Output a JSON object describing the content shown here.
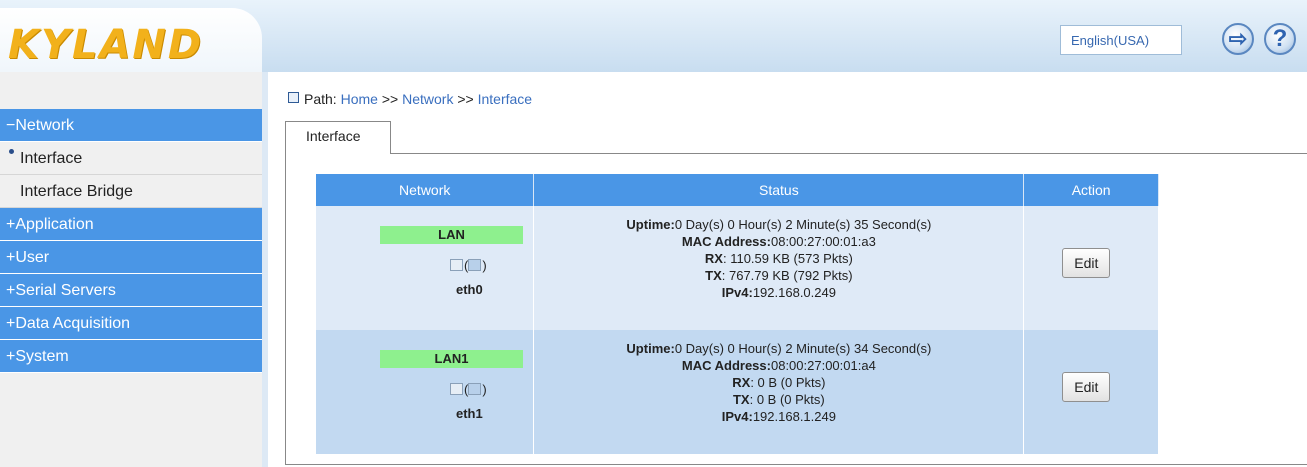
{
  "header": {
    "logo": "KYLAND",
    "language": "English(USA)",
    "exit_icon": "logout-icon",
    "help_icon": "?"
  },
  "sidebar": {
    "items": [
      {
        "label": "−Network",
        "type": "group"
      },
      {
        "label": "Interface",
        "type": "sub",
        "active": true
      },
      {
        "label": "Interface Bridge",
        "type": "sub"
      },
      {
        "label": "+Application",
        "type": "group"
      },
      {
        "label": "+User",
        "type": "group"
      },
      {
        "label": "+Serial Servers",
        "type": "group"
      },
      {
        "label": "+Data Acquisition",
        "type": "group"
      },
      {
        "label": "+System",
        "type": "group"
      }
    ]
  },
  "breadcrumb": {
    "prefix": "Path:",
    "home": "Home",
    "sep1": ">>",
    "network": "Network",
    "sep2": ">>",
    "interface": "Interface"
  },
  "tab": {
    "label": "Interface"
  },
  "table": {
    "headers": [
      "Network",
      "Status",
      "Action"
    ],
    "rows": [
      {
        "name": "LAN",
        "icon_text": "(",
        "icon_text2": ")",
        "iface": "eth0",
        "uptime_label": "Uptime:",
        "uptime": "0 Day(s) 0 Hour(s) 2 Minute(s) 35 Second(s)",
        "mac_label": "MAC Address:",
        "mac": "08:00:27:00:01:a3",
        "rx_label": "RX",
        "rx": ": 110.59 KB (573 Pkts)",
        "tx_label": "TX",
        "tx": ": 767.79 KB (792 Pkts)",
        "ipv4_label": "IPv4:",
        "ipv4": "192.168.0.249",
        "action": "Edit"
      },
      {
        "name": "LAN1",
        "icon_text": "(",
        "icon_text2": ")",
        "iface": "eth1",
        "uptime_label": "Uptime:",
        "uptime": "0 Day(s) 0 Hour(s) 2 Minute(s) 34 Second(s)",
        "mac_label": "MAC Address:",
        "mac": "08:00:27:00:01:a4",
        "rx_label": "RX",
        "rx": ": 0 B (0 Pkts)",
        "tx_label": "TX",
        "tx": ": 0 B (0 Pkts)",
        "ipv4_label": "IPv4:",
        "ipv4": "192.168.1.249",
        "action": "Edit"
      }
    ]
  },
  "colors": {
    "menu_blue": "#4a96e6",
    "lan_green": "#8ef08e",
    "row_light": "#dfeaf7",
    "row_dark": "#c2d9f1",
    "logo_yellow": "#f2b11b"
  }
}
